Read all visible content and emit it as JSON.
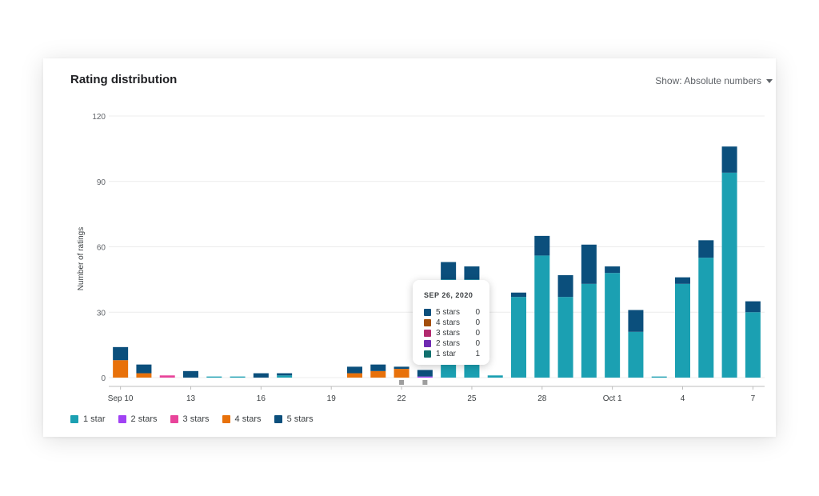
{
  "card": {
    "title": "Rating distribution",
    "show_label": "Show: Absolute numbers",
    "show_icon": "caret-down-icon"
  },
  "tooltip": {
    "date": "SEP 26, 2020",
    "rows": [
      {
        "label": "5 stars",
        "value": "0",
        "color": "#0b4f7c"
      },
      {
        "label": "4 stars",
        "value": "0",
        "color": "#a34e0b"
      },
      {
        "label": "3 stars",
        "value": "0",
        "color": "#b22a6e"
      },
      {
        "label": "2 stars",
        "value": "0",
        "color": "#6f2ab2"
      },
      {
        "label": "1 star",
        "value": "1",
        "color": "#11706e"
      }
    ]
  },
  "chart_data": {
    "type": "bar",
    "stacked": true,
    "ylabel": "Number of ratings",
    "ylim": [
      0,
      120
    ],
    "yticks": [
      "0",
      "30",
      "60",
      "90",
      "120"
    ],
    "grid": true,
    "legend_position": "bottom-left",
    "categories": [
      "Sep 10",
      "Sep 11",
      "Sep 12",
      "Sep 13",
      "Sep 14",
      "Sep 15",
      "Sep 16",
      "Sep 17",
      "Sep 18",
      "Sep 19",
      "Sep 20",
      "Sep 21",
      "Sep 22",
      "Sep 23",
      "Sep 24",
      "Sep 25",
      "Sep 26",
      "Sep 27",
      "Sep 28",
      "Sep 29",
      "Sep 30",
      "Oct 1",
      "Oct 2",
      "Oct 3",
      "Oct 4",
      "Oct 5",
      "Oct 6",
      "Oct 7"
    ],
    "tick_labels": [
      "Sep 10",
      "",
      "",
      "13",
      "",
      "",
      "16",
      "",
      "",
      "19",
      "",
      "",
      "22",
      "",
      "",
      "25",
      "",
      "",
      "28",
      "",
      "",
      "Oct 1",
      "",
      "",
      "4",
      "",
      "",
      "7"
    ],
    "series": [
      {
        "name": "1 star",
        "color": "#1ba0b2",
        "values": [
          0,
          0,
          0,
          0,
          0.5,
          0.5,
          0,
          1,
          0,
          0,
          0,
          0,
          0,
          0,
          45,
          45,
          1,
          37,
          56,
          37,
          43,
          48,
          21,
          0.5,
          43,
          55,
          94,
          30
        ]
      },
      {
        "name": "2 stars",
        "color": "#a142f4",
        "values": [
          0,
          0,
          0,
          0,
          0,
          0,
          0,
          0,
          0,
          0,
          0,
          0,
          0,
          0.5,
          0,
          0,
          0,
          0,
          0,
          0,
          0,
          0,
          0,
          0,
          0,
          0,
          0,
          0
        ]
      },
      {
        "name": "3 stars",
        "color": "#e8449a",
        "values": [
          0,
          0,
          1,
          0,
          0,
          0,
          0,
          0,
          0,
          0,
          0,
          0,
          0,
          0,
          0,
          0,
          0,
          0,
          0,
          0,
          0,
          0,
          0,
          0,
          0,
          0,
          0,
          0
        ]
      },
      {
        "name": "4 stars",
        "color": "#e8710a",
        "values": [
          8,
          2,
          0,
          0,
          0,
          0,
          0,
          0,
          0,
          0,
          2,
          3,
          4,
          0,
          0,
          0,
          0,
          0,
          0,
          0,
          0,
          0,
          0,
          0,
          0,
          0,
          0,
          0
        ]
      },
      {
        "name": "5 stars",
        "color": "#0b4f7c",
        "values": [
          6,
          4,
          0,
          3,
          0,
          0,
          2,
          1,
          0,
          0,
          3,
          3,
          1,
          3,
          8,
          6,
          0,
          2,
          9,
          10,
          18,
          3,
          10,
          0,
          3,
          8,
          12,
          5
        ]
      }
    ]
  }
}
